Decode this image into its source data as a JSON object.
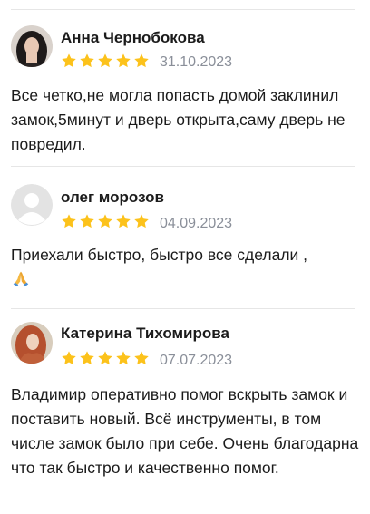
{
  "reviews": [
    {
      "author": "Анна Чернобокова",
      "rating": 5,
      "date": "31.10.2023",
      "text": "Все четко,не могла попасть домой заклинил замок,5минут и дверь открыта,саму дверь не повредил.",
      "avatar": "photo-avatar-dark-hair"
    },
    {
      "author": "олег морозов",
      "rating": 5,
      "date": "04.09.2023",
      "text": "Приехали быстро, быстро все сделали ,",
      "emoji": "folded-hands-icon",
      "avatar": "default-user-icon"
    },
    {
      "author": "Катерина Тихомирова",
      "rating": 5,
      "date": "07.07.2023",
      "text": "Владимир оперативно помог вскрыть замок и поставить новый. Всё инструменты, в том числе замок было при себе. Очень благодарна что так быстро и качественно помог.",
      "avatar": "photo-avatar-red-hair"
    }
  ],
  "colors": {
    "star": "#fcc21b",
    "date": "#8a8f99",
    "divider": "#e6e6e6"
  }
}
